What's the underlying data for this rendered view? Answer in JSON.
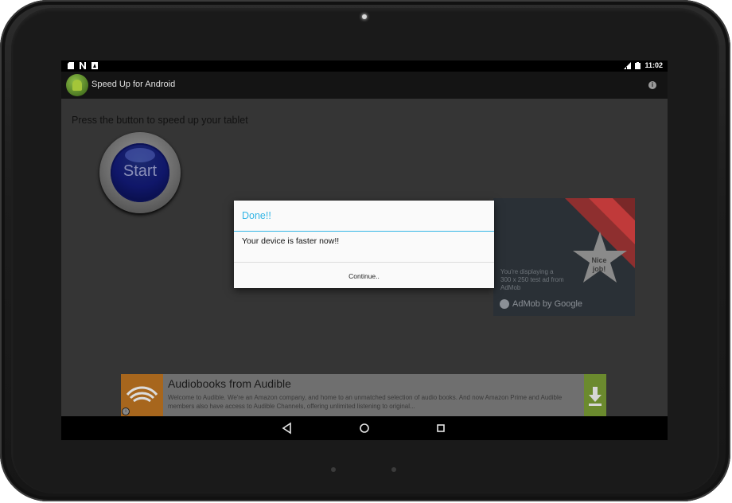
{
  "status_bar": {
    "time": "11:02"
  },
  "app_bar": {
    "title": "Speed Up for Android"
  },
  "main": {
    "prompt": "Press the button to speed up your tablet",
    "start_label": "Start"
  },
  "ad": {
    "star_text": "Nice job!",
    "text": "You're displaying a 300 x 250 test ad from AdMob",
    "brand": "AdMob by Google"
  },
  "banner": {
    "title": "Audiobooks from Audible",
    "description": "Welcome to Audible. We're an Amazon company, and home to an unmatched selection of audio books. And now Amazon Prime and Audible members also have access to Audible Channels, offering unlimited listening to original..."
  },
  "dialog": {
    "title": "Done!!",
    "message": "Your device is faster now!!",
    "button_label": "Continue.."
  },
  "colors": {
    "dialog_accent": "#33b5e5",
    "start_button": "#10176a",
    "ad_red": "#c03a3a"
  }
}
